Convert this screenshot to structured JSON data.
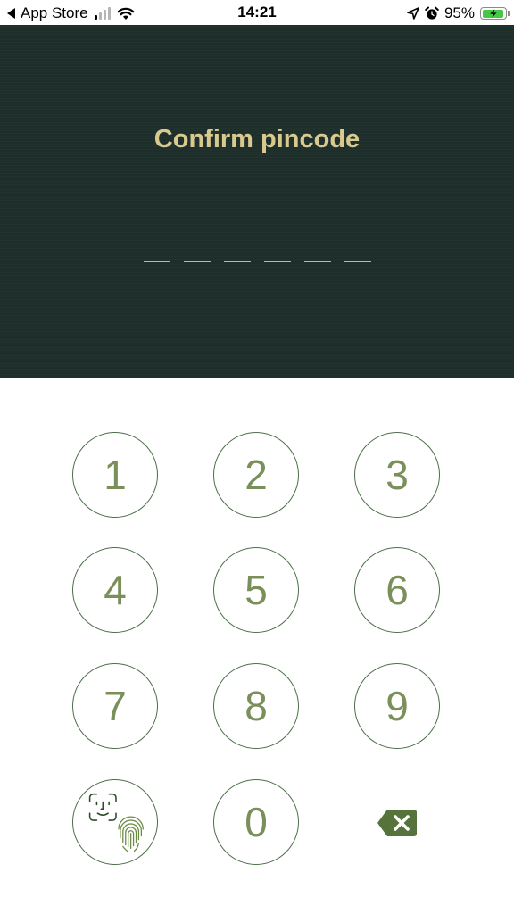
{
  "status_bar": {
    "back_label": "App Store",
    "time": "14:21",
    "battery_percent": "95%",
    "battery_level": 0.95,
    "signal_bars_active": 1,
    "signal_bars_total": 4,
    "icons": [
      "back-arrow-icon",
      "cellular-signal-icon",
      "wifi-icon",
      "location-arrow-icon",
      "alarm-icon",
      "battery-charging-icon"
    ]
  },
  "header": {
    "title": "Confirm pincode",
    "background_color": "#1e2e2a",
    "title_color": "#d8c98e",
    "pin_length": 6,
    "pin_entered": 0
  },
  "keypad": {
    "keys": [
      "1",
      "2",
      "3",
      "4",
      "5",
      "6",
      "7",
      "8",
      "9",
      "0"
    ],
    "biometric_icons": [
      "face-id-icon",
      "fingerprint-icon"
    ],
    "delete_icon": "backspace-icon",
    "key_text_color": "#7a8f59",
    "key_border_color": "#4d6f49"
  }
}
